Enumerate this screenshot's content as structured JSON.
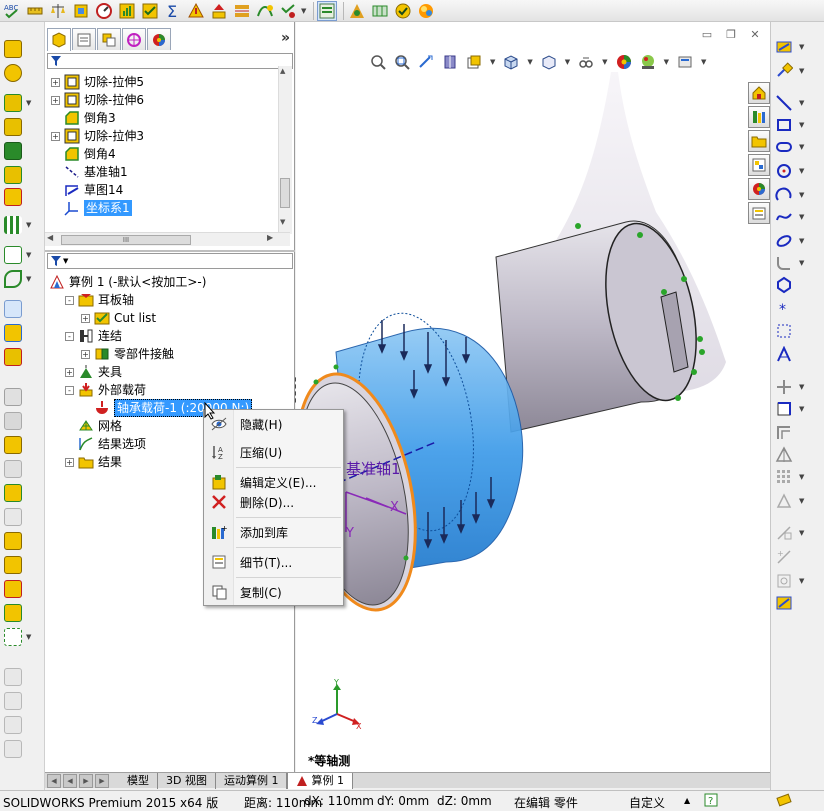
{
  "top_toolbar": {
    "icons": [
      "spell-check-icon",
      "measure-icon",
      "mass-properties-icon",
      "section-properties-icon",
      "sensor-icon",
      "statistics-icon",
      "check-icon",
      "equation-icon",
      "draft-analysis-icon",
      "undercut-icon",
      "parting-line-icon",
      "curvature-icon",
      "feature-statistics-icon",
      "simulation-icon",
      "design-study-icon",
      "evaluate-icon",
      "render-icon"
    ]
  },
  "feature_tree": {
    "filter_icon": "funnel-icon",
    "items": [
      {
        "label": "切除-拉伸5",
        "icon": "cut-extrude-icon",
        "expandable": true
      },
      {
        "label": "切除-拉伸6",
        "icon": "cut-extrude-icon",
        "expandable": true
      },
      {
        "label": "倒角3",
        "icon": "chamfer-icon",
        "expandable": false
      },
      {
        "label": "切除-拉伸3",
        "icon": "cut-extrude-icon",
        "expandable": true
      },
      {
        "label": "倒角4",
        "icon": "chamfer-icon",
        "expandable": false
      },
      {
        "label": "基准轴1",
        "icon": "axis-icon",
        "expandable": false
      },
      {
        "label": "草图14",
        "icon": "sketch-icon",
        "expandable": false
      },
      {
        "label": "坐标系1",
        "icon": "coordinate-system-icon",
        "expandable": false,
        "selected": true
      }
    ],
    "hscroll_label": "III"
  },
  "study_tree": {
    "filter_icon": "funnel-icon",
    "items": [
      {
        "label": "算例 1 (-默认<按加工>-)",
        "indent": 0,
        "exp": "",
        "icon": "study-icon"
      },
      {
        "label": "耳板轴",
        "indent": 1,
        "exp": "-",
        "icon": "part-icon"
      },
      {
        "label": "Cut list",
        "indent": 2,
        "exp": "+",
        "icon": "cut-list-icon"
      },
      {
        "label": "连结",
        "indent": 1,
        "exp": "-",
        "icon": "connections-icon"
      },
      {
        "label": "零部件接触",
        "indent": 2,
        "exp": "+",
        "icon": "contact-icon"
      },
      {
        "label": "夹具",
        "indent": 1,
        "exp": "+",
        "icon": "fixture-icon"
      },
      {
        "label": "外部载荷",
        "indent": 1,
        "exp": "-",
        "icon": "external-load-icon"
      },
      {
        "label": "轴承载荷-1 (:20000 N:)",
        "indent": 2,
        "exp": "",
        "icon": "bearing-load-icon",
        "highlighted": true
      },
      {
        "label": "网格",
        "indent": 1,
        "exp": "",
        "icon": "mesh-icon"
      },
      {
        "label": "结果选项",
        "indent": 1,
        "exp": "",
        "icon": "result-options-icon"
      },
      {
        "label": "结果",
        "indent": 1,
        "exp": "+",
        "icon": "results-folder-icon"
      }
    ]
  },
  "context_menu": {
    "items": [
      {
        "label": "隐藏(H)",
        "icon": "hide-icon"
      },
      {
        "label": "压缩(U)",
        "icon": "suppress-icon"
      },
      {
        "label": "编辑定义(E)...",
        "icon": "edit-definition-icon"
      },
      {
        "label": "删除(D)...",
        "icon": "delete-icon"
      },
      {
        "label": "添加到库",
        "icon": "add-to-library-icon"
      },
      {
        "label": "细节(T)...",
        "icon": "details-icon"
      },
      {
        "label": "复制(C)",
        "icon": "copy-icon"
      }
    ]
  },
  "viewport": {
    "view_name": "*等轴测",
    "axis_label": "基准轴1",
    "triad": {
      "x": "X",
      "y": "Y",
      "z": "Z"
    },
    "coord_labels": {
      "x": "X",
      "y": "Y"
    },
    "colors": {
      "load_blue": "#3d9be9",
      "body_gray": "#c7c3cf",
      "edge_orange": "#f08a1c",
      "mesh_green": "#2aa52a"
    }
  },
  "bottom_tabs": [
    "模型",
    "3D 视图",
    "运动算例 1",
    "算例 1"
  ],
  "status_bar": {
    "app": "SOLIDWORKS Premium 2015 x64 版",
    "distance": "距离: 110mm",
    "dx": "dX: 110mm",
    "dy": "dY: 0mm",
    "dz": "dZ: 0mm",
    "mode": "在编辑 零件",
    "custom": "自定义"
  }
}
